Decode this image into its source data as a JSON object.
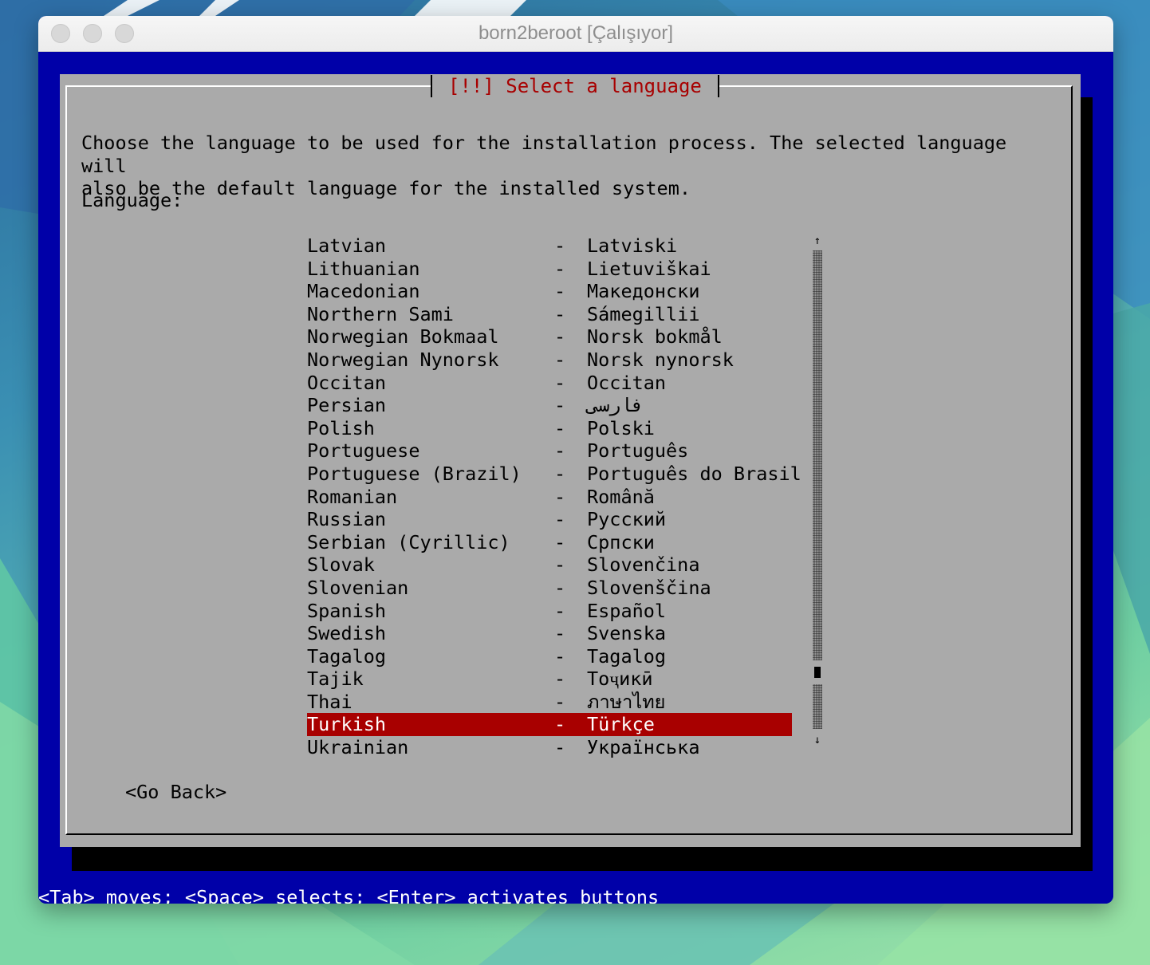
{
  "window": {
    "title": "born2beroot [Çalışıyor]"
  },
  "dialog": {
    "title": "[!!] Select a language",
    "prompt": "Choose the language to be used for the installation process. The selected language will\nalso be the default language for the installed system.",
    "field_label": "Language:",
    "languages": [
      {
        "name": "Latvian",
        "native": "Latviski"
      },
      {
        "name": "Lithuanian",
        "native": "Lietuviškai"
      },
      {
        "name": "Macedonian",
        "native": "Македонски"
      },
      {
        "name": "Northern Sami",
        "native": "Sámegillii"
      },
      {
        "name": "Norwegian Bokmaal",
        "native": "Norsk bokmål"
      },
      {
        "name": "Norwegian Nynorsk",
        "native": "Norsk nynorsk"
      },
      {
        "name": "Occitan",
        "native": "Occitan"
      },
      {
        "name": "Persian",
        "native": "فارسی"
      },
      {
        "name": "Polish",
        "native": "Polski"
      },
      {
        "name": "Portuguese",
        "native": "Português"
      },
      {
        "name": "Portuguese (Brazil)",
        "native": "Português do Brasil"
      },
      {
        "name": "Romanian",
        "native": "Română"
      },
      {
        "name": "Russian",
        "native": "Русский"
      },
      {
        "name": "Serbian (Cyrillic)",
        "native": "Српски"
      },
      {
        "name": "Slovak",
        "native": "Slovenčina"
      },
      {
        "name": "Slovenian",
        "native": "Slovenščina"
      },
      {
        "name": "Spanish",
        "native": "Español"
      },
      {
        "name": "Swedish",
        "native": "Svenska"
      },
      {
        "name": "Tagalog",
        "native": "Tagalog"
      },
      {
        "name": "Tajik",
        "native": "Тоҷикӣ"
      },
      {
        "name": "Thai",
        "native": "ภาษาไทย"
      },
      {
        "name": "Turkish",
        "native": "Türkçe",
        "selected": true
      },
      {
        "name": "Ukrainian",
        "native": "Українська"
      }
    ],
    "separator": "-",
    "scroll_up_arrow": "↑",
    "scroll_down_arrow": "↓",
    "go_back_label": "<Go Back>"
  },
  "statusline": {
    "text": "<Tab> moves; <Space> selects; <Enter> activates buttons"
  },
  "colors": {
    "terminal_blue": "#0000a8",
    "dialog_gray": "#aaaaaa",
    "title_red": "#a80000",
    "selection_red": "#a80000"
  }
}
